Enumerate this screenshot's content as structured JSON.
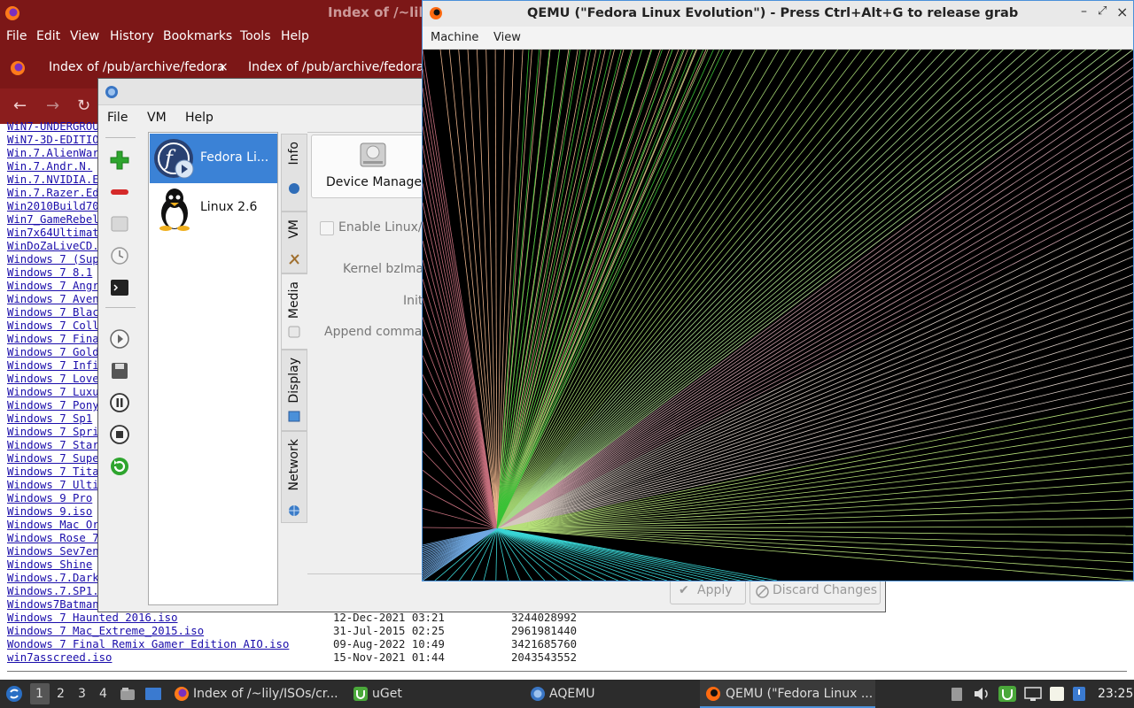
{
  "firefox": {
    "title": "Index of /~lily",
    "menu": [
      "File",
      "Edit",
      "View",
      "History",
      "Bookmarks",
      "Tools",
      "Help"
    ],
    "tabs": [
      {
        "label": "Index of /pub/archive/fedora"
      },
      {
        "label": "Index of /pub/archive/fedora"
      }
    ],
    "tab_close": "×",
    "files": [
      {
        "name": "WiN7-UNDERGROU"
      },
      {
        "name": "WiN7-3D-EDITIO"
      },
      {
        "name": "Win.7.AlienWar"
      },
      {
        "name": "Win.7.Andr.N."
      },
      {
        "name": "Win.7.NVIDIA.E"
      },
      {
        "name": "Win.7.Razer.Ed"
      },
      {
        "name": "Win2010Build70"
      },
      {
        "name": "Win7_GameRebel"
      },
      {
        "name": "Win7x64Ultimat"
      },
      {
        "name": "WinDoZaLiveCD."
      },
      {
        "name": "Windows 7 (Sup"
      },
      {
        "name": "Windows 7 8.1"
      },
      {
        "name": "Windows 7 Angr"
      },
      {
        "name": "Windows 7 Aven"
      },
      {
        "name": "Windows 7 Blac"
      },
      {
        "name": "Windows 7 Coll"
      },
      {
        "name": "Windows 7 Fina"
      },
      {
        "name": "Windows 7 Gold"
      },
      {
        "name": "Windows 7 Infi"
      },
      {
        "name": "Windows 7 Love"
      },
      {
        "name": "Windows 7 Luxu"
      },
      {
        "name": "Windows 7 Pony"
      },
      {
        "name": "Windows 7 Sp1"
      },
      {
        "name": "Windows 7 Spri"
      },
      {
        "name": "Windows 7 Star"
      },
      {
        "name": "Windows 7 Supe"
      },
      {
        "name": "Windows 7 Tita"
      },
      {
        "name": "Windows 7 Ulti"
      },
      {
        "name": "Windows 9 Pro"
      },
      {
        "name": "Windows 9.iso"
      },
      {
        "name": "Windows Mac Or"
      },
      {
        "name": "Windows Rose 7"
      },
      {
        "name": "Windows Sev7en"
      },
      {
        "name": "Windows Shine"
      },
      {
        "name": "Windows.7.Dark"
      },
      {
        "name": "Windows.7.SP1."
      },
      {
        "name": "Windows7Batman"
      },
      {
        "name": "Windows 7 Haunted 2016.iso",
        "date": "12-Dec-2021 03:21",
        "size": "3244028992"
      },
      {
        "name": "Windows 7 Mac_Extreme_2015.iso",
        "date": "31-Jul-2015 02:25",
        "size": "2961981440"
      },
      {
        "name": "Wondows 7 Final Remix Gamer Edition AIO.iso",
        "date": "09-Aug-2022 10:49",
        "size": "3421685760"
      },
      {
        "name": "win7asscreed.iso",
        "date": "15-Nov-2021 01:44",
        "size": "2043543552"
      }
    ]
  },
  "aqemu": {
    "menu": [
      "File",
      "VM",
      "Help"
    ],
    "vms": [
      {
        "label": "Fedora Li...",
        "selected": true
      },
      {
        "label": "Linux 2.6",
        "selected": false
      }
    ],
    "tabs": [
      "Info",
      "VM",
      "Media",
      "Display",
      "Network"
    ],
    "active_tab": "Media",
    "device_manager_label": "Device Manager",
    "enable_linux_label": "Enable Linux/I",
    "kernel_label": "Kernel bzImag",
    "initrd_label": "Initi",
    "append_label": "Append comman",
    "apply_label": "Apply",
    "discard_label": "Discard Changes"
  },
  "qemu": {
    "title": "QEMU (\"Fedora Linux Evolution\") - Press Ctrl+Alt+G to release grab",
    "menu": [
      "Machine",
      "View"
    ],
    "controls": [
      "–",
      "⤢",
      "×"
    ]
  },
  "taskbar": {
    "workspaces": [
      "1",
      "2",
      "3",
      "4"
    ],
    "tasks": [
      {
        "label": "Index of /~lily/ISOs/cr..."
      },
      {
        "label": "uGet"
      },
      {
        "label": "AQEMU"
      },
      {
        "label": "QEMU (\"Fedora Linux ..."
      }
    ],
    "clock": "23:25"
  },
  "colors": {
    "firefox_title": "#7c1717",
    "selection": "#3b82d6",
    "qemu_border": "#4a90d9",
    "taskbar": "#2c2c2c"
  }
}
